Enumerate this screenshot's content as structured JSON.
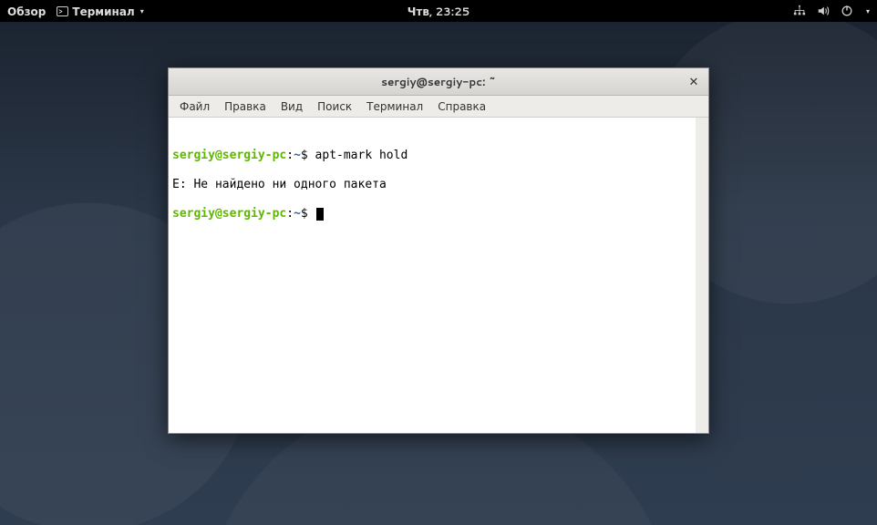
{
  "topbar": {
    "activities": "Обзор",
    "app_label": "Терминал",
    "clock": "Чтв, 23:25"
  },
  "window": {
    "title": "sergiy@sergiy-pc: ~"
  },
  "menubar": {
    "file": "Файл",
    "edit": "Правка",
    "view": "Вид",
    "search": "Поиск",
    "terminal": "Терминал",
    "help": "Справка"
  },
  "terminal": {
    "prompt_user": "sergiy@sergiy-pc",
    "prompt_path": "~",
    "dollar": "$",
    "line1_cmd": " apt-mark hold",
    "line2_output": "E: Не найдено ни одного пакета",
    "line3_cmd": " "
  }
}
